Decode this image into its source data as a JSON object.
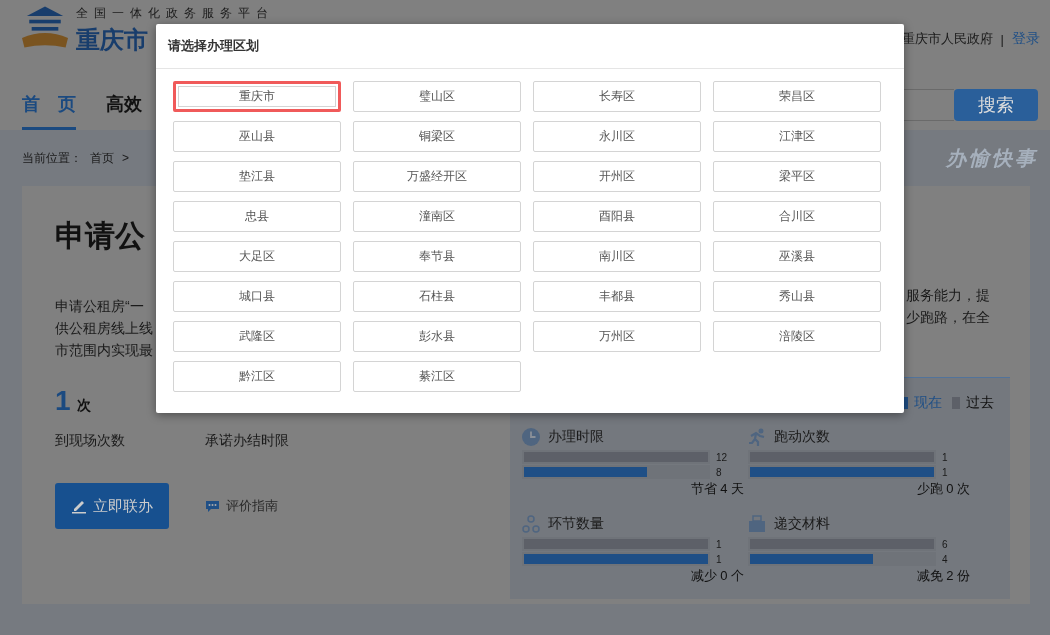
{
  "header": {
    "tagline": "全国一体化政务服务平台",
    "site_title": "重庆市",
    "links": [
      {
        "label": "重庆市人民政府"
      },
      {
        "label": "登录"
      }
    ],
    "separator": "|"
  },
  "nav": {
    "items": [
      {
        "label": "首　页",
        "selected": true
      },
      {
        "label": "高效",
        "selected": false
      }
    ],
    "search_button": "搜索"
  },
  "breadcrumb": {
    "label": "当前位置：",
    "items": [
      "首页",
      ">"
    ],
    "slogan": "办愉快事"
  },
  "service": {
    "title": "申请公",
    "description_left": [
      "申请公租房“一",
      "供公租房线上线",
      "市范围内实现最"
    ],
    "description_right": [
      "服务能力，提",
      "少跑路，在全"
    ],
    "stats": [
      {
        "value": "1",
        "unit": "次",
        "label": "到现场次数"
      },
      {
        "label": "承诺办结时限"
      }
    ],
    "primary_button": "立即联办",
    "secondary_link": "评价指南"
  },
  "comparison": {
    "legend": [
      {
        "label": "现在",
        "color": "#1f4f86"
      },
      {
        "label": "过去",
        "color": "#5d6068"
      }
    ],
    "metrics": [
      {
        "kind": "clock",
        "title": "办理时限",
        "past": {
          "value": "12",
          "level": 1
        },
        "now": {
          "value": "8",
          "level": 0.667
        },
        "summary": "节省 4 天"
      },
      {
        "kind": "run",
        "title": "跑动次数",
        "past": {
          "value": "1",
          "level": 1
        },
        "now": {
          "value": "1",
          "level": 1
        },
        "summary": "少跑 0 次"
      },
      {
        "kind": "steps",
        "title": "环节数量",
        "past": {
          "value": "1",
          "level": 1
        },
        "now": {
          "value": "1",
          "level": 1
        },
        "summary": "减少 0 个"
      },
      {
        "kind": "docs",
        "title": "递交材料",
        "past": {
          "value": "6",
          "level": 1
        },
        "now": {
          "value": "4",
          "level": 0.667
        },
        "summary": "减免 2 份"
      }
    ]
  },
  "dialog": {
    "title": "请选择办理区划",
    "regions": [
      {
        "label": "重庆市",
        "selected": true
      },
      {
        "label": "璧山区",
        "selected": false
      },
      {
        "label": "长寿区",
        "selected": false
      },
      {
        "label": "荣昌区",
        "selected": false
      },
      {
        "label": "巫山县",
        "selected": false
      },
      {
        "label": "铜梁区",
        "selected": false
      },
      {
        "label": "永川区",
        "selected": false
      },
      {
        "label": "江津区",
        "selected": false
      },
      {
        "label": "垫江县",
        "selected": false
      },
      {
        "label": "万盛经开区",
        "selected": false
      },
      {
        "label": "开州区",
        "selected": false
      },
      {
        "label": "梁平区",
        "selected": false
      },
      {
        "label": "忠县",
        "selected": false
      },
      {
        "label": "潼南区",
        "selected": false
      },
      {
        "label": "酉阳县",
        "selected": false
      },
      {
        "label": "合川区",
        "selected": false
      },
      {
        "label": "大足区",
        "selected": false
      },
      {
        "label": "奉节县",
        "selected": false
      },
      {
        "label": "南川区",
        "selected": false
      },
      {
        "label": "巫溪县",
        "selected": false
      },
      {
        "label": "城口县",
        "selected": false
      },
      {
        "label": "石柱县",
        "selected": false
      },
      {
        "label": "丰都县",
        "selected": false
      },
      {
        "label": "秀山县",
        "selected": false
      },
      {
        "label": "武隆区",
        "selected": false
      },
      {
        "label": "彭水县",
        "selected": false
      },
      {
        "label": "万州区",
        "selected": false
      },
      {
        "label": "涪陵区",
        "selected": false
      },
      {
        "label": "黔江区",
        "selected": false
      },
      {
        "label": "綦江区",
        "selected": false
      }
    ]
  }
}
